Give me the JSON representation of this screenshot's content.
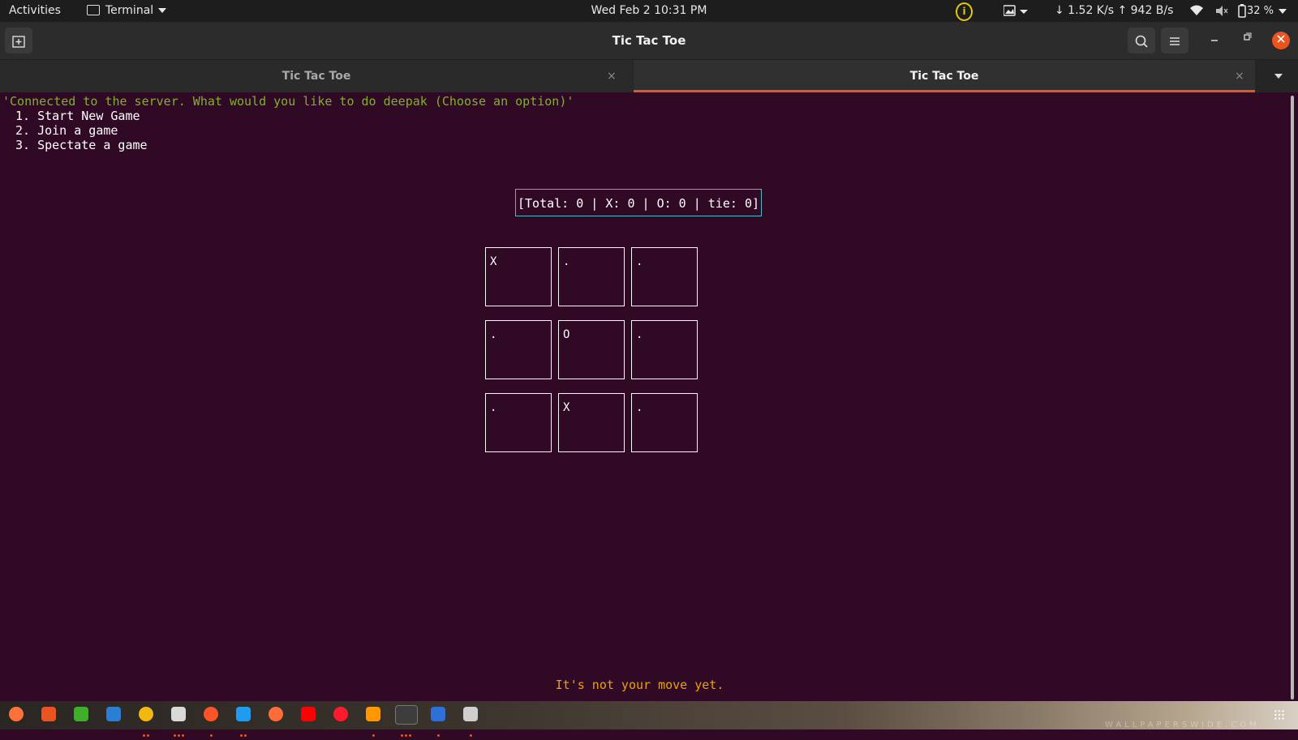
{
  "topbar": {
    "activities": "Activities",
    "app_name": "Terminal",
    "clock": "Wed Feb 2  10:31 PM",
    "info_symbol": "i",
    "net_speed": "↓ 1.52 K/s ↑ 942 B/s",
    "battery": "32 %"
  },
  "window": {
    "title": "Tic Tac Toe"
  },
  "tabs": [
    {
      "label": "Tic Tac Toe",
      "close": "×",
      "active": false
    },
    {
      "label": "Tic Tac Toe",
      "close": "×",
      "active": true
    }
  ],
  "terminal": {
    "status_line": "'Connected to the server. What would you like to do deepak (Choose an option)'",
    "options": [
      "1. Start New Game",
      "2. Join a game",
      "3. Spectate a game"
    ],
    "scoreboard": "[Total: 0 | X: 0 | O: 0 | tie: 0]",
    "board": [
      [
        "X",
        ".",
        "."
      ],
      [
        ".",
        "O",
        "."
      ],
      [
        ".",
        "X",
        "."
      ]
    ],
    "move_status": "It's not your move yet."
  },
  "dock": {
    "apps": [
      {
        "name": "firefox-icon",
        "color": "#ff7139",
        "dots": 0
      },
      {
        "name": "software-center-icon",
        "color": "#e95420",
        "dots": 0
      },
      {
        "name": "inkscape-icon",
        "color": "#3fae2a",
        "dots": 0
      },
      {
        "name": "thunderbird-icon",
        "color": "#2a7fd4",
        "dots": 0
      },
      {
        "name": "chrome-icon",
        "color": "#f2b80f",
        "dots": 2
      },
      {
        "name": "files-icon",
        "color": "#d9d9d9",
        "dots": 3
      },
      {
        "name": "brave-icon",
        "color": "#fb542b",
        "dots": 1
      },
      {
        "name": "vscode-icon",
        "color": "#1f9cf0",
        "dots": 2
      },
      {
        "name": "postman-icon",
        "color": "#ff6c37",
        "dots": 0
      },
      {
        "name": "youtube-icon",
        "color": "#ff0000",
        "dots": 0
      },
      {
        "name": "opera-icon",
        "color": "#ff1b2d",
        "dots": 0
      },
      {
        "name": "sublime-text-icon",
        "color": "#ff9800",
        "dots": 1
      },
      {
        "name": "terminal-icon",
        "color": "#4a4a4a",
        "dots": 3
      },
      {
        "name": "writer-icon",
        "color": "#2e6fd8",
        "dots": 1
      },
      {
        "name": "text-editor-icon",
        "color": "#cfcfcf",
        "dots": 1
      }
    ],
    "watermark": "WALLPAPERSWIDE.COM"
  },
  "colors": {
    "terminal_bg": "#300a24",
    "accent": "#e95420",
    "status_green": "#7eb22b",
    "status_orange": "#e9a10c"
  }
}
